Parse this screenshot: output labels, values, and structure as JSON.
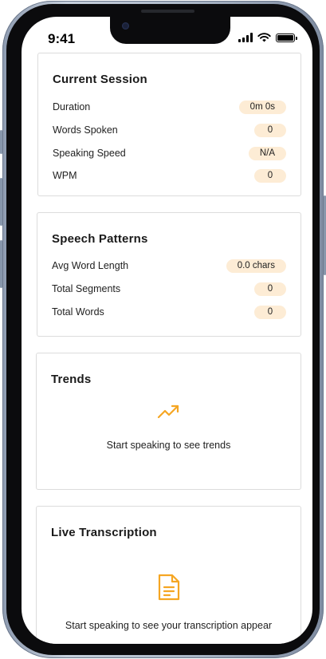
{
  "status_bar": {
    "time": "9:41"
  },
  "current_session": {
    "title": "Current Session",
    "rows": [
      {
        "label": "Duration",
        "value": "0m 0s"
      },
      {
        "label": "Words Spoken",
        "value": "0"
      },
      {
        "label": "Speaking Speed",
        "value": "N/A"
      },
      {
        "label": "WPM",
        "value": "0"
      }
    ]
  },
  "speech_patterns": {
    "title": "Speech Patterns",
    "rows": [
      {
        "label": "Avg Word Length",
        "value": "0.0 chars"
      },
      {
        "label": "Total Segments",
        "value": "0"
      },
      {
        "label": "Total Words",
        "value": "0"
      }
    ]
  },
  "trends": {
    "title": "Trends",
    "icon": "trending-up-icon",
    "empty_message": "Start speaking to see trends"
  },
  "live_transcription": {
    "title": "Live Transcription",
    "icon": "document-icon",
    "empty_message": "Start speaking to see your transcription appear"
  },
  "colors": {
    "accent": "#f5a623",
    "pill_background": "#fdecd5",
    "card_border": "#dcdcdc"
  }
}
